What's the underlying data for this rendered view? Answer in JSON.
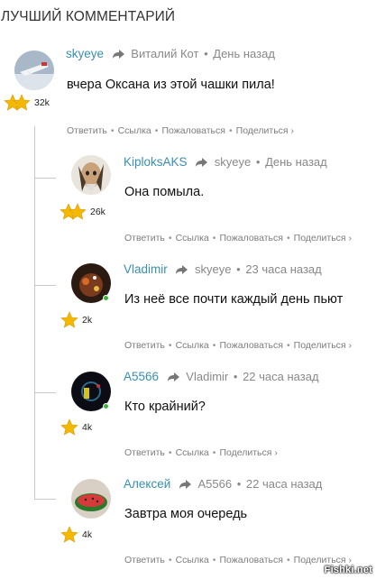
{
  "heading": "ЛУЧШИЙ КОММЕНТАРИЙ",
  "actions": {
    "reply": "Ответить",
    "link": "Ссылка",
    "report": "Пожаловаться",
    "share": "Поделиться ›"
  },
  "comments": [
    {
      "author": "skyeye",
      "reply_to": "Виталий Кот",
      "time": "День назад",
      "text": "вчера Оксана из этой чашки пила!",
      "rating": "32k",
      "stars": 2
    },
    {
      "author": "KiplоksAKS",
      "reply_to": "skyeye",
      "time": "День назад",
      "text": "Она помыла.",
      "rating": "26k",
      "stars": 2
    },
    {
      "author": "Vladimir",
      "reply_to": "skyeye",
      "time": "23 часа назад",
      "text": "Из неё все почти каждый день пьют",
      "rating": "2k",
      "stars": 1
    },
    {
      "author": "A5566",
      "reply_to": "Vladimir",
      "time": "22 часа назад",
      "text": "Кто крайний?",
      "rating": "4k",
      "stars": 1
    },
    {
      "author": "Алексей",
      "reply_to": "A5566",
      "time": "22 часа назад",
      "text": "Завтра моя очередь",
      "rating": "4k",
      "stars": 1
    }
  ],
  "watermark": "Fishki.net",
  "colors": {
    "author": "#3a8fb0",
    "star": "#f5b800",
    "thread_line": "#c8c8c8",
    "online": "#3bb53b"
  },
  "icons": {
    "reply": "reply-arrow-icon",
    "rating": "star-icon"
  }
}
